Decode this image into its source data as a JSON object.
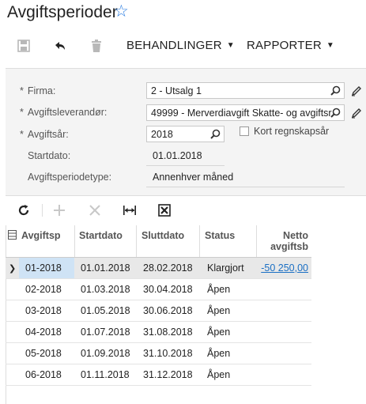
{
  "page": {
    "title": "Avgiftsperioder"
  },
  "toolbar": {
    "behandlinger": "BEHANDLINGER",
    "rapporter": "RAPPORTER"
  },
  "form": {
    "firma_label": "Firma:",
    "firma_value": "2 - Utsalg 1",
    "leverandor_label": "Avgiftsleverandør:",
    "leverandor_value": "49999 - Merverdiavgift Skatte- og avgiftsr",
    "avgiftsar_label": "Avgiftsår:",
    "avgiftsar_value": "2018",
    "kort_label": "Kort regnskapsår",
    "startdato_label": "Startdato:",
    "startdato_value": "01.01.2018",
    "periodetype_label": "Avgiftsperiodetype:",
    "periodetype_value": "Annenhver måned"
  },
  "grid": {
    "columns": [
      "Avgiftsp",
      "Startdato",
      "Sluttdato",
      "Status",
      "Netto",
      "avgiftsb"
    ],
    "rows": [
      {
        "period": "01-2018",
        "start": "01.01.2018",
        "end": "28.02.2018",
        "status": "Klargjort",
        "netto": "-50 250,00"
      },
      {
        "period": "02-2018",
        "start": "01.03.2018",
        "end": "30.04.2018",
        "status": "Åpen",
        "netto": ""
      },
      {
        "period": "03-2018",
        "start": "01.05.2018",
        "end": "30.06.2018",
        "status": "Åpen",
        "netto": ""
      },
      {
        "period": "04-2018",
        "start": "01.07.2018",
        "end": "31.08.2018",
        "status": "Åpen",
        "netto": ""
      },
      {
        "period": "05-2018",
        "start": "01.09.2018",
        "end": "31.10.2018",
        "status": "Åpen",
        "netto": ""
      },
      {
        "period": "06-2018",
        "start": "01.11.2018",
        "end": "31.12.2018",
        "status": "Åpen",
        "netto": ""
      }
    ]
  },
  "icons": {
    "star": "star-icon",
    "save": "save-icon",
    "undo": "undo-icon",
    "delete": "trash-icon",
    "search": "search-icon",
    "edit": "pencil-icon",
    "refresh": "refresh-icon",
    "add": "plus-icon",
    "remove": "close-icon",
    "fit": "fit-columns-icon",
    "excel": "excel-export-icon"
  },
  "colors": {
    "accent": "#2a7de1",
    "link": "#1a6fc4",
    "selected_cell": "#cfe3f5"
  }
}
